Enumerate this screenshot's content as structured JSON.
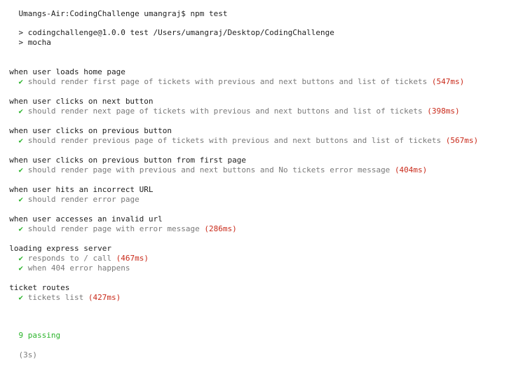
{
  "prompt": {
    "text": "Umangs-Air:CodingChallenge umangraj$ npm test"
  },
  "npm": {
    "script_line": "> codingchallenge@1.0.0 test /Users/umangraj/Desktop/CodingChallenge",
    "command_line": "> mocha"
  },
  "icons": {
    "check": "✔"
  },
  "colors": {
    "pass": "#2bb42b",
    "slow_duration": "#c92a1a",
    "muted_text": "#7a7a7a"
  },
  "suites": [
    {
      "title": "when user loads home page",
      "tests": [
        {
          "title": "should render first page of tickets with previous and next buttons and list of tickets",
          "duration": "(547ms)"
        }
      ]
    },
    {
      "title": "when user clicks on next button",
      "tests": [
        {
          "title": "should render next page of tickets with previous and next buttons and list of tickets",
          "duration": "(398ms)"
        }
      ]
    },
    {
      "title": "when user clicks on previous button",
      "tests": [
        {
          "title": "should render previous page of tickets with previous and next buttons and list of tickets",
          "duration": "(567ms)"
        }
      ]
    },
    {
      "title": "when user clicks on previous button from first page",
      "tests": [
        {
          "title": "should render page with previous and next buttons and No tickets error message",
          "duration": "(404ms)"
        }
      ]
    },
    {
      "title": "when user hits an incorrect URL",
      "tests": [
        {
          "title": "should render error page",
          "duration": ""
        }
      ]
    },
    {
      "title": "when user accesses an invalid url",
      "tests": [
        {
          "title": "should render page with error message",
          "duration": "(286ms)"
        }
      ]
    },
    {
      "title": "loading express server",
      "tests": [
        {
          "title": "responds to / call",
          "duration": "(467ms)"
        },
        {
          "title": "when 404 error happens",
          "duration": ""
        }
      ]
    },
    {
      "title": "ticket routes",
      "tests": [
        {
          "title": "tickets list",
          "duration": "(427ms)"
        }
      ]
    }
  ],
  "summary": {
    "passing": "9 passing",
    "time": "(3s)"
  }
}
